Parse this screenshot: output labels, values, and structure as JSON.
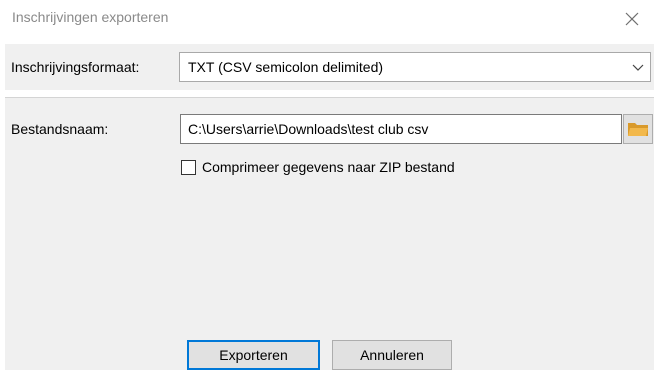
{
  "window": {
    "title": "Inschrijvingen exporteren"
  },
  "format": {
    "label": "Inschrijvingsformaat:",
    "selected": "TXT (CSV semicolon delimited)"
  },
  "file": {
    "label": "Bestandsnaam:",
    "path": "C:\\Users\\arrie\\Downloads\\test club csv"
  },
  "zip": {
    "label": "Comprimeer gegevens naar ZIP bestand",
    "checked": false
  },
  "buttons": {
    "export": "Exporteren",
    "cancel": "Annuleren"
  },
  "icons": {
    "close": "close-icon",
    "chevron": "chevron-down-icon",
    "folder": "folder-icon"
  },
  "colors": {
    "accent": "#0078d7",
    "folder": "#f2b84b"
  }
}
